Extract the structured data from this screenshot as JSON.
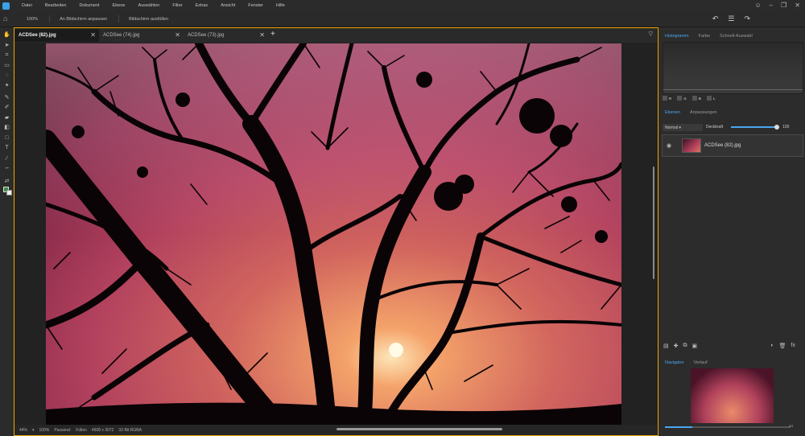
{
  "menu": [
    "Datei",
    "Bearbeiten",
    "Dokument",
    "Ebene",
    "Auswählen",
    "Filter",
    "Extras",
    "Ansicht",
    "Fenster",
    "Hilfe"
  ],
  "context_toolbar": {
    "zoom": "100%",
    "fit_label": "An Bildschirm anpassen",
    "fill_label": "Bildschirm ausfüllen"
  },
  "tabs": [
    {
      "label": "ACDSee (82).jpg",
      "active": true
    },
    {
      "label": "ACDSee (74).jpg",
      "active": false
    },
    {
      "label": "ACDSee (73).jpg",
      "active": false
    }
  ],
  "status": {
    "zoom": "44%",
    "zoom100": "100%",
    "fit_label": "Passend:",
    "fill_label": "Füllen",
    "dimensions": "4608 x 3072",
    "color_mode": "32-Bit RGBA"
  },
  "panels": {
    "top_tabs": [
      "Histogramm",
      "Farbe",
      "Schnell-Auswahl"
    ],
    "histogram_checks": [
      "R",
      "G",
      "B",
      "L"
    ],
    "mid_tabs": [
      "Ebenen",
      "Anpassungen"
    ],
    "blend_mode": "Normal",
    "opacity_label": "Deckkraft",
    "opacity_value": "100",
    "opacity_fraction": 1.0,
    "layer_name": "ACDSee (82).jpg",
    "bottom_tabs": [
      "Navigator",
      "Verlauf"
    ],
    "navigator_zoom_label": "44"
  },
  "colors": {
    "accent": "#4aa6f0",
    "document_border": "#f0a800"
  }
}
